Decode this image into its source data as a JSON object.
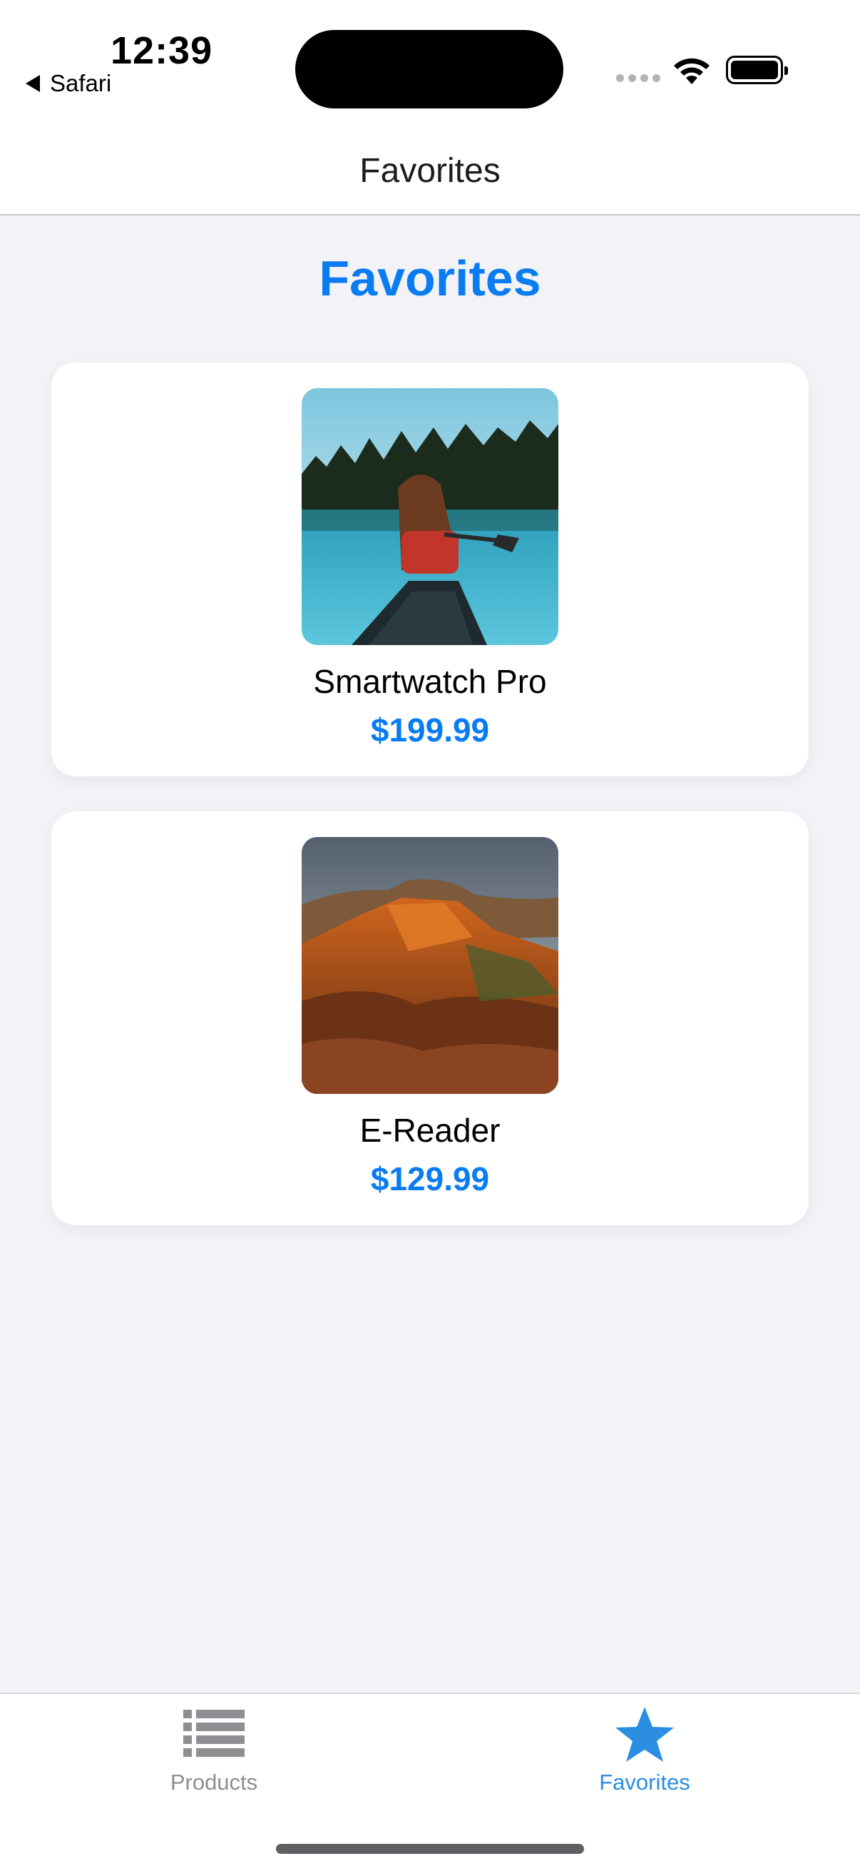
{
  "status_bar": {
    "time": "12:39",
    "back_app": "Safari"
  },
  "nav": {
    "title": "Favorites"
  },
  "page": {
    "title": "Favorites"
  },
  "favorites": [
    {
      "name": "Smartwatch Pro",
      "price": "$199.99",
      "image": "canoe-lake-photo"
    },
    {
      "name": "E-Reader",
      "price": "$129.99",
      "image": "red-rock-canyon-photo"
    }
  ],
  "tabs": [
    {
      "label": "Products",
      "icon": "list-icon",
      "selected": false
    },
    {
      "label": "Favorites",
      "icon": "star-icon",
      "selected": true
    }
  ],
  "colors": {
    "accent": "#0a7cf2",
    "tab_selected": "#2b8ee0",
    "tab_unselected": "#8e8e93",
    "background": "#f2f2f7"
  }
}
